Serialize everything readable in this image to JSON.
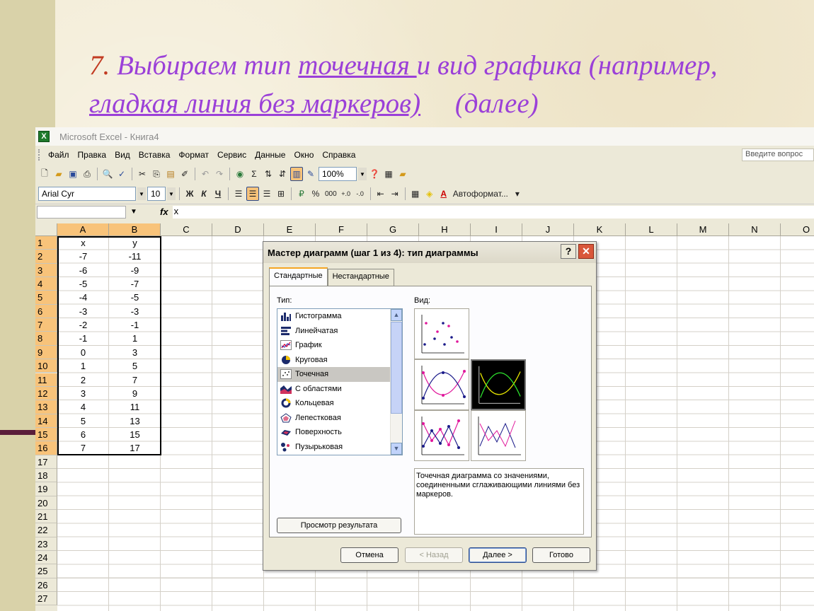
{
  "slide": {
    "number": "7.",
    "title_part1": " Выбираем тип ",
    "title_underlined1": "точечная ",
    "title_part2": "и вид графика (например, ",
    "title_underlined2": "гладкая линия без маркеров)",
    "title_part3": "     (далее)"
  },
  "excel": {
    "window_title": "Microsoft Excel - Книга4",
    "menu": [
      "Файл",
      "Правка",
      "Вид",
      "Вставка",
      "Формат",
      "Сервис",
      "Данные",
      "Окно",
      "Справка"
    ],
    "help_placeholder": "Введите вопрос",
    "zoom": "100%",
    "font_name": "Arial Cyr",
    "font_size": "10",
    "bold_label": "Ж",
    "italic_label": "К",
    "underline_label": "Ч",
    "percent_label": "%",
    "thousands_label": "000",
    "autoformat_label": "Автоформат...",
    "formula_value": "x",
    "columns": [
      "A",
      "B",
      "C",
      "D",
      "E",
      "F",
      "G",
      "H",
      "I",
      "J",
      "K",
      "L",
      "M",
      "N",
      "O"
    ],
    "rows": [
      "1",
      "2",
      "3",
      "4",
      "5",
      "6",
      "7",
      "8",
      "9",
      "10",
      "11",
      "12",
      "13",
      "14",
      "15",
      "16",
      "17",
      "18",
      "19",
      "20",
      "21",
      "22",
      "23",
      "24",
      "25",
      "26",
      "27"
    ],
    "data_x": [
      "x",
      "-7",
      "-6",
      "-5",
      "-4",
      "-3",
      "-2",
      "-1",
      "0",
      "1",
      "2",
      "3",
      "4",
      "5",
      "6",
      "7"
    ],
    "data_y": [
      "y",
      "-11",
      "-9",
      "-7",
      "-5",
      "-3",
      "-1",
      "1",
      "3",
      "5",
      "7",
      "9",
      "11",
      "13",
      "15",
      "17"
    ]
  },
  "dialog": {
    "title": "Мастер диаграмм (шаг 1 из 4): тип диаграммы",
    "help_button": "?",
    "tabs": [
      "Стандартные",
      "Нестандартные"
    ],
    "type_label": "Тип:",
    "view_label": "Вид:",
    "chart_types": [
      "Гистограмма",
      "Линейчатая",
      "График",
      "Круговая",
      "Точечная",
      "С областями",
      "Кольцевая",
      "Лепестковая",
      "Поверхность",
      "Пузырьковая"
    ],
    "selected_type": "Точечная",
    "description": "Точечная диаграмма со значениями, соединенными сглаживающими линиями без маркеров.",
    "preview_button": "Просмотр результата",
    "cancel_button": "Отмена",
    "back_button": "< Назад",
    "next_button": "Далее >",
    "finish_button": "Готово"
  },
  "colors": {
    "title": "#9b40d8",
    "number": "#c23b22",
    "selected_header": "#f8c37a"
  }
}
